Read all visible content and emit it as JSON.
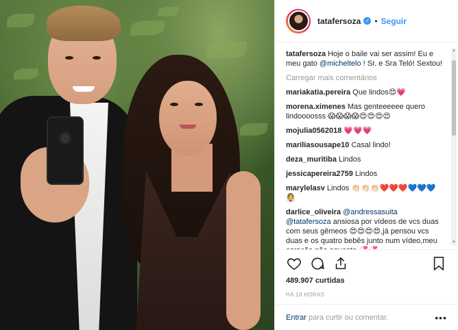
{
  "post": {
    "author": "tatafersoza",
    "follow_label": "Seguir",
    "dot": "•",
    "caption": {
      "username": "tatafersoza",
      "text_before": "Hoje o baile vai ser assim! Eu e meu gato ",
      "mention": "@micheltelo",
      "text_after": " ! Sr. e Sra Teló! Sextou!"
    },
    "load_more": "Carregar mais comentários",
    "comments": [
      {
        "user": "mariakatia.pereira",
        "text": "Que lindos😍💗"
      },
      {
        "user": "morena.ximenes",
        "text": "Mas genteeeeee quero lindoooosss 😱😱😱😱😍😍😍😍"
      },
      {
        "user": "mojulia0562018",
        "text": "💗💗💗"
      },
      {
        "user": "mariliasousape10",
        "text": "Casal lindo!"
      },
      {
        "user": "deza_muritiba",
        "text": "Lindos"
      },
      {
        "user": "jessicapereira2759",
        "text": "Lindos"
      },
      {
        "user": "marylelasv",
        "text": "Lindos 👏🏻👏🏻👏🏻❤️❤️❤️💙💙💙👰"
      },
      {
        "user": "darlice_oliveira",
        "mention": "@andressasuita",
        "mention2": "@tatafersoza",
        "text": " ansiosa por vídeos de vcs duas com seus gêmeos 😍😍😍😍,já pensou vcs duas e os quatro bebês junto num vídeo,meu coração não aguenta 💞💞"
      }
    ],
    "likes": "489.907 curtidas",
    "time": "HÁ 18 HORAS",
    "add_comment": {
      "enter": "Entrar",
      "rest": " para curtir ou comentar."
    },
    "more": "•••"
  },
  "icons": {
    "like": "heart-icon",
    "comment": "comment-icon",
    "share": "share-icon",
    "save": "bookmark-icon"
  },
  "colors": {
    "link": "#3897f0",
    "mention": "#003569",
    "muted": "#999999"
  }
}
